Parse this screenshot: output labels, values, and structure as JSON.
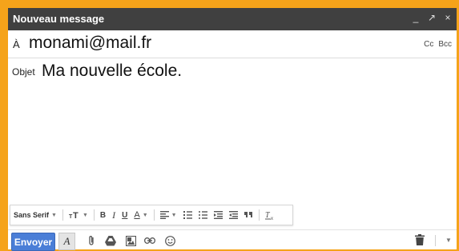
{
  "window": {
    "title": "Nouveau message",
    "controls": [
      "_",
      "↗",
      "×"
    ]
  },
  "to": {
    "label": "À",
    "value": "monami@mail.fr",
    "cc": "Cc",
    "bcc": "Bcc"
  },
  "subject": {
    "label": "Objet",
    "value": "Ma nouvelle école."
  },
  "format_toolbar": {
    "font": "Sans Serif",
    "size_icon": "text-size-icon",
    "bold": "B",
    "italic": "I",
    "underline": "U",
    "text_color": "A"
  },
  "actions": {
    "send": "Envoyer",
    "format_toggle": "A"
  },
  "colors": {
    "frame": "#f5a31a",
    "titlebar": "#404040",
    "send_button": "#4a7ed7"
  }
}
